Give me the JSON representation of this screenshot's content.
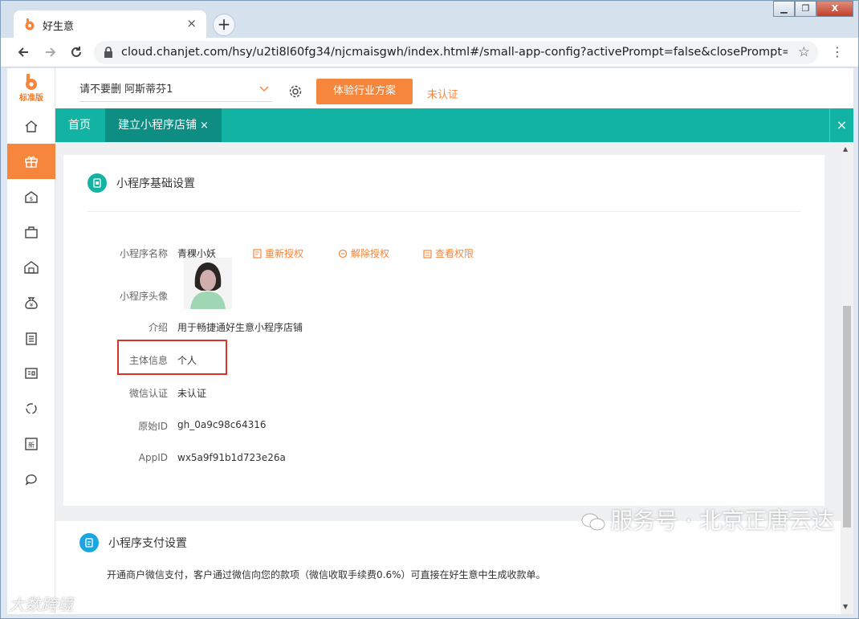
{
  "browser": {
    "tab_title": "好生意",
    "tab_close": "×",
    "new_tab": "+",
    "url": "cloud.chanjet.com/hsy/u2ti8l60fg34/njcmaisgwh/index.html#/small-app-config?activePrompt=false&closePrompt=false...",
    "window_controls": [
      "▁",
      "❐",
      "X"
    ]
  },
  "app": {
    "logo_text": "标准版",
    "company_name": "请不要删 阿斯蒂芬1",
    "try_button": "体验行业方案",
    "status": "未认证",
    "sidebar_icons": [
      "home-icon",
      "gift-icon",
      "shop-icon",
      "bag-icon",
      "warehouse-icon",
      "money-bag-icon",
      "clipboard-icon",
      "report-icon",
      "refresh-cycle-icon",
      "new-icon",
      "chat-icon"
    ],
    "tabs": [
      {
        "label": "首页"
      },
      {
        "label": "建立小程序店铺",
        "close": "×"
      }
    ],
    "tabs_close": "×"
  },
  "basic_settings": {
    "title": "小程序基础设置",
    "name_label": "小程序名称",
    "name_value": "青稞小妖",
    "actions": [
      "重新授权",
      "解除授权",
      "查看权限"
    ],
    "avatar_label": "小程序头像",
    "intro_label": "介绍",
    "intro_value": "用于畅捷通好生意小程序店铺",
    "subject_label": "主体信息",
    "subject_value": "个人",
    "wechat_auth_label": "微信认证",
    "wechat_auth_value": "未认证",
    "original_id_label": "原始ID",
    "original_id_value": "gh_0a9c98c64316",
    "appid_label": "AppID",
    "appid_value": "wx5a9f91b1d723e26a"
  },
  "payment_settings": {
    "title": "小程序支付设置",
    "description": "开通商户微信支付，客户通过微信向您的款项（微信收取手续费0.6%）可直接在好生意中生成收款单。"
  },
  "watermarks": {
    "main": "服务号 · 北京正唐云达",
    "corner": "大数跨境"
  },
  "colors": {
    "accent_orange": "#f5863c",
    "teal": "#13b3a3",
    "highlight_red": "#d9332c"
  }
}
